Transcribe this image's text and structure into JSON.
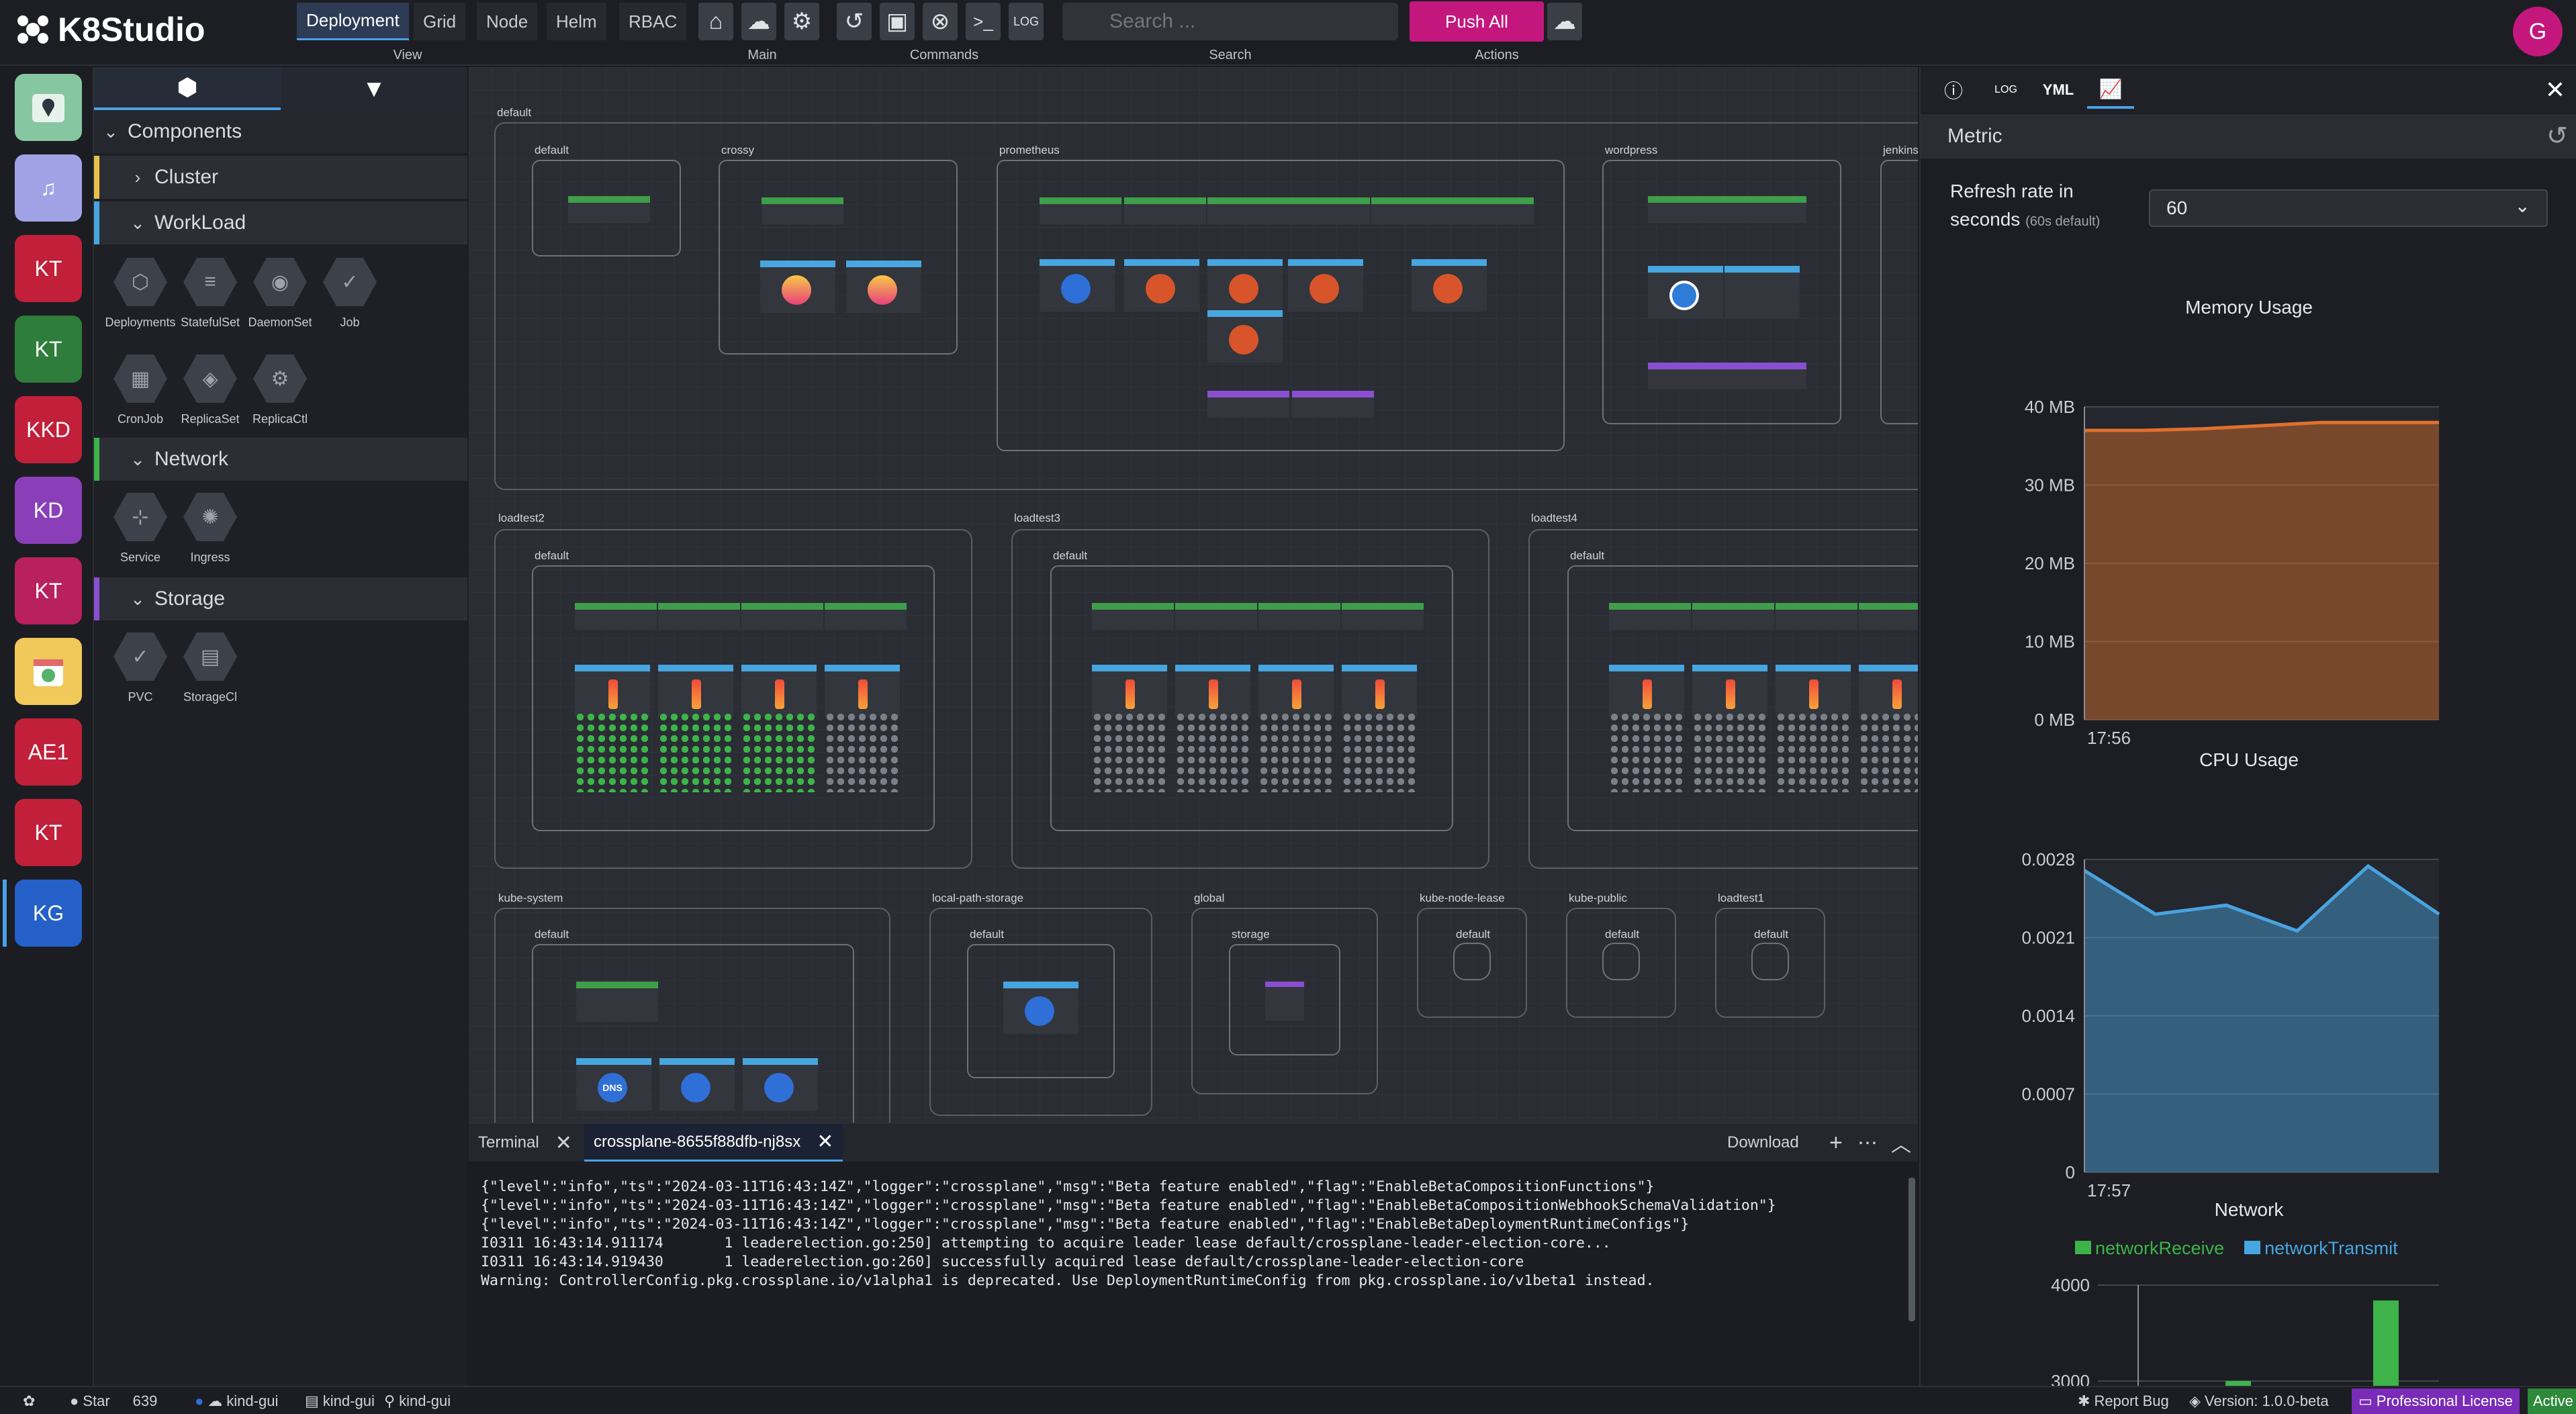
{
  "app": {
    "name": "K8Studio"
  },
  "topbar": {
    "view_tabs": [
      "Deployment",
      "Grid",
      "Node",
      "Helm",
      "RBAC"
    ],
    "active_view": "Deployment",
    "captions": {
      "view": "View",
      "main": "Main",
      "commands": "Commands",
      "search": "Search",
      "actions": "Actions"
    },
    "search_placeholder": "Search ...",
    "push_all": "Push All",
    "avatar_initial": "G"
  },
  "rail": {
    "clusters": [
      "KT",
      "KT",
      "KKD",
      "KD",
      "KT",
      "AE1",
      "KT",
      "KG"
    ],
    "active": "KG"
  },
  "sidebar": {
    "section_components": "Components",
    "section_cluster": "Cluster",
    "section_workload": "WorkLoad",
    "section_network": "Network",
    "section_storage": "Storage",
    "workload_items": [
      "Deployments",
      "StatefulSet",
      "DaemonSet",
      "Job",
      "CronJob",
      "ReplicaSet",
      "ReplicaCtl"
    ],
    "network_items": [
      "Service",
      "Ingress"
    ],
    "storage_items": [
      "PVC",
      "StorageCl"
    ]
  },
  "canvas": {
    "namespaces": {
      "default": "default",
      "crossy": "crossy",
      "prometheus": "prometheus",
      "wordpress": "wordpress",
      "jenkins": "jenkins",
      "loadtest2": "loadtest2",
      "loadtest3": "loadtest3",
      "loadtest4": "loadtest4",
      "kube_system": "kube-system",
      "local_path_storage": "local-path-storage",
      "global": "global",
      "kube_node_lease": "kube-node-lease",
      "kube_public": "kube-public",
      "loadtest1": "loadtest1"
    },
    "inner_default": "default",
    "inner_storage": "storage",
    "dns_label": "DNS"
  },
  "panel": {
    "tabs": [
      "info",
      "log",
      "YML",
      "metric"
    ],
    "yml_label": "YML",
    "header": "Metric",
    "refresh_label": "Refresh rate in seconds",
    "refresh_hint": "(60s default)",
    "refresh_value": "60"
  },
  "chart_data": [
    {
      "type": "area",
      "title": "Memory Usage",
      "x": [
        "17:56"
      ],
      "yticks": [
        "40 MB",
        "30 MB",
        "20 MB",
        "10 MB",
        "0 MB"
      ],
      "ylim": [
        0,
        40
      ],
      "values": [
        37,
        37,
        37.2,
        37.6,
        38,
        38,
        38
      ],
      "color": "#e0702e",
      "grid": true
    },
    {
      "type": "area",
      "title": "CPU Usage",
      "x": [
        "17:57"
      ],
      "yticks": [
        "0.0028",
        "0.0021",
        "0.0014",
        "0.0007",
        "0"
      ],
      "ylim": [
        0,
        0.0028
      ],
      "values": [
        0.0027,
        0.00231,
        0.00239,
        0.00216,
        0.00274,
        0.00231
      ],
      "color": "#4aa3e0",
      "grid": true
    },
    {
      "type": "bar",
      "title": "Network",
      "series": [
        {
          "name": "networkReceive",
          "color": "#3db34a"
        },
        {
          "name": "networkTransmit",
          "color": "#47a6e0"
        }
      ],
      "yticks": [
        "4000",
        "3000"
      ],
      "values": [
        3000,
        3840
      ],
      "ylim": [
        2600,
        4000
      ],
      "grid": true
    }
  ],
  "terminal": {
    "tab_terminal": "Terminal",
    "tab_pod": "crossplane-8655f88dfb-nj8sx",
    "download": "Download",
    "lines": [
      "{\"level\":\"info\",\"ts\":\"2024-03-11T16:43:14Z\",\"logger\":\"crossplane\",\"msg\":\"Beta feature enabled\",\"flag\":\"EnableBetaCompositionFunctions\"}",
      "{\"level\":\"info\",\"ts\":\"2024-03-11T16:43:14Z\",\"logger\":\"crossplane\",\"msg\":\"Beta feature enabled\",\"flag\":\"EnableBetaCompositionWebhookSchemaValidation\"}",
      "{\"level\":\"info\",\"ts\":\"2024-03-11T16:43:14Z\",\"logger\":\"crossplane\",\"msg\":\"Beta feature enabled\",\"flag\":\"EnableBetaDeploymentRuntimeConfigs\"}",
      "I0311 16:43:14.911174       1 leaderelection.go:250] attempting to acquire leader lease default/crossplane-leader-election-core...",
      "I0311 16:43:14.919430       1 leaderelection.go:260] successfully acquired lease default/crossplane-leader-election-core",
      "Warning: ControllerConfig.pkg.crossplane.io/v1alpha1 is deprecated. Use DeploymentRuntimeConfig from pkg.crossplane.io/v1beta1 instead."
    ]
  },
  "statusbar": {
    "star": "Star",
    "star_count": "639",
    "ctx1": "kind-gui",
    "ctx2": "kind-gui",
    "ctx3": "kind-gui",
    "report_bug": "Report Bug",
    "version": "Version: 1.0.0-beta",
    "license": "Professional License",
    "status": "Active"
  }
}
